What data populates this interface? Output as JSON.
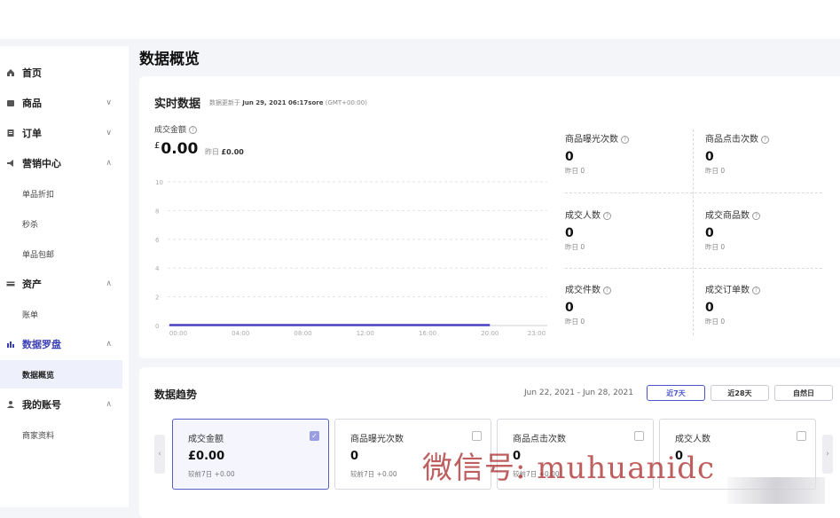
{
  "page_title": "数据概览",
  "sidebar": {
    "items": [
      {
        "label": "首页",
        "icon": "home-icon",
        "chevron": ""
      },
      {
        "label": "商品",
        "icon": "product-icon",
        "chevron": "∨"
      },
      {
        "label": "订单",
        "icon": "order-icon",
        "chevron": "∨"
      },
      {
        "label": "营销中心",
        "icon": "megaphone-icon",
        "chevron": "∧"
      },
      {
        "label": "资产",
        "icon": "wallet-icon",
        "chevron": "∧"
      },
      {
        "label": "数据罗盘",
        "icon": "bar-chart-icon",
        "chevron": "∧"
      },
      {
        "label": "我的账号",
        "icon": "user-icon",
        "chevron": "∧"
      }
    ],
    "marketing_sub": [
      "单品折扣",
      "秒杀",
      "单品包邮"
    ],
    "asset_sub": [
      "账单"
    ],
    "data_sub": [
      "数据概览"
    ],
    "account_sub": [
      "商家资料"
    ]
  },
  "realtime": {
    "title": "实时数据",
    "updated_prefix": "数据更新于",
    "updated_time": "Jun 29, 2021 06:17sore",
    "timezone": "(GMT+00:00)",
    "sales_label": "成交金额",
    "currency": "£",
    "sales_value": "0.00",
    "yesterday_label": "昨日",
    "yesterday_value": "£0.00"
  },
  "chart_data": {
    "type": "line",
    "x": [
      "00:00",
      "04:00",
      "08:00",
      "12:00",
      "16:00",
      "20:00",
      "23:00"
    ],
    "yticks": [
      0,
      2,
      4,
      6,
      8,
      10
    ],
    "ylim": [
      0,
      10
    ],
    "series": [
      {
        "values": [
          0,
          0,
          0,
          0,
          0,
          0
        ],
        "x_end": "20:00"
      }
    ],
    "grid": true,
    "line_color": "#4b3fc4"
  },
  "stats": [
    {
      "label": "商品曝光次数",
      "value": "0",
      "yest": "昨日 0"
    },
    {
      "label": "商品点击次数",
      "value": "0",
      "yest": "昨日 0"
    },
    {
      "label": "成交人数",
      "value": "0",
      "yest": "昨日 0"
    },
    {
      "label": "成交商品数",
      "value": "0",
      "yest": "昨日 0"
    },
    {
      "label": "成交件数",
      "value": "0",
      "yest": "昨日 0"
    },
    {
      "label": "成交订单数",
      "value": "0",
      "yest": "昨日 0"
    }
  ],
  "trend": {
    "title": "数据趋势",
    "date_range": "Jun 22, 2021 - Jun 28, 2021",
    "buttons": [
      "近7天",
      "近28天",
      "自然日"
    ],
    "cards": [
      {
        "label": "成交金额",
        "value": "£0.00",
        "compare": "较前7日 +0.00",
        "checked": true
      },
      {
        "label": "商品曝光次数",
        "value": "0",
        "compare": "较前7日 +0.00",
        "checked": false
      },
      {
        "label": "商品点击次数",
        "value": "0",
        "compare": "较前7日 +0.00",
        "checked": false
      },
      {
        "label": "成交人数",
        "value": "0",
        "compare": "",
        "checked": false
      }
    ],
    "prev_arrow": "‹",
    "next_arrow": "›"
  },
  "watermark": "微信号: muhuanidc",
  "colors": {
    "accent": "#4b55c8",
    "line": "#4b3fc4",
    "background": "#f4f5f8"
  }
}
